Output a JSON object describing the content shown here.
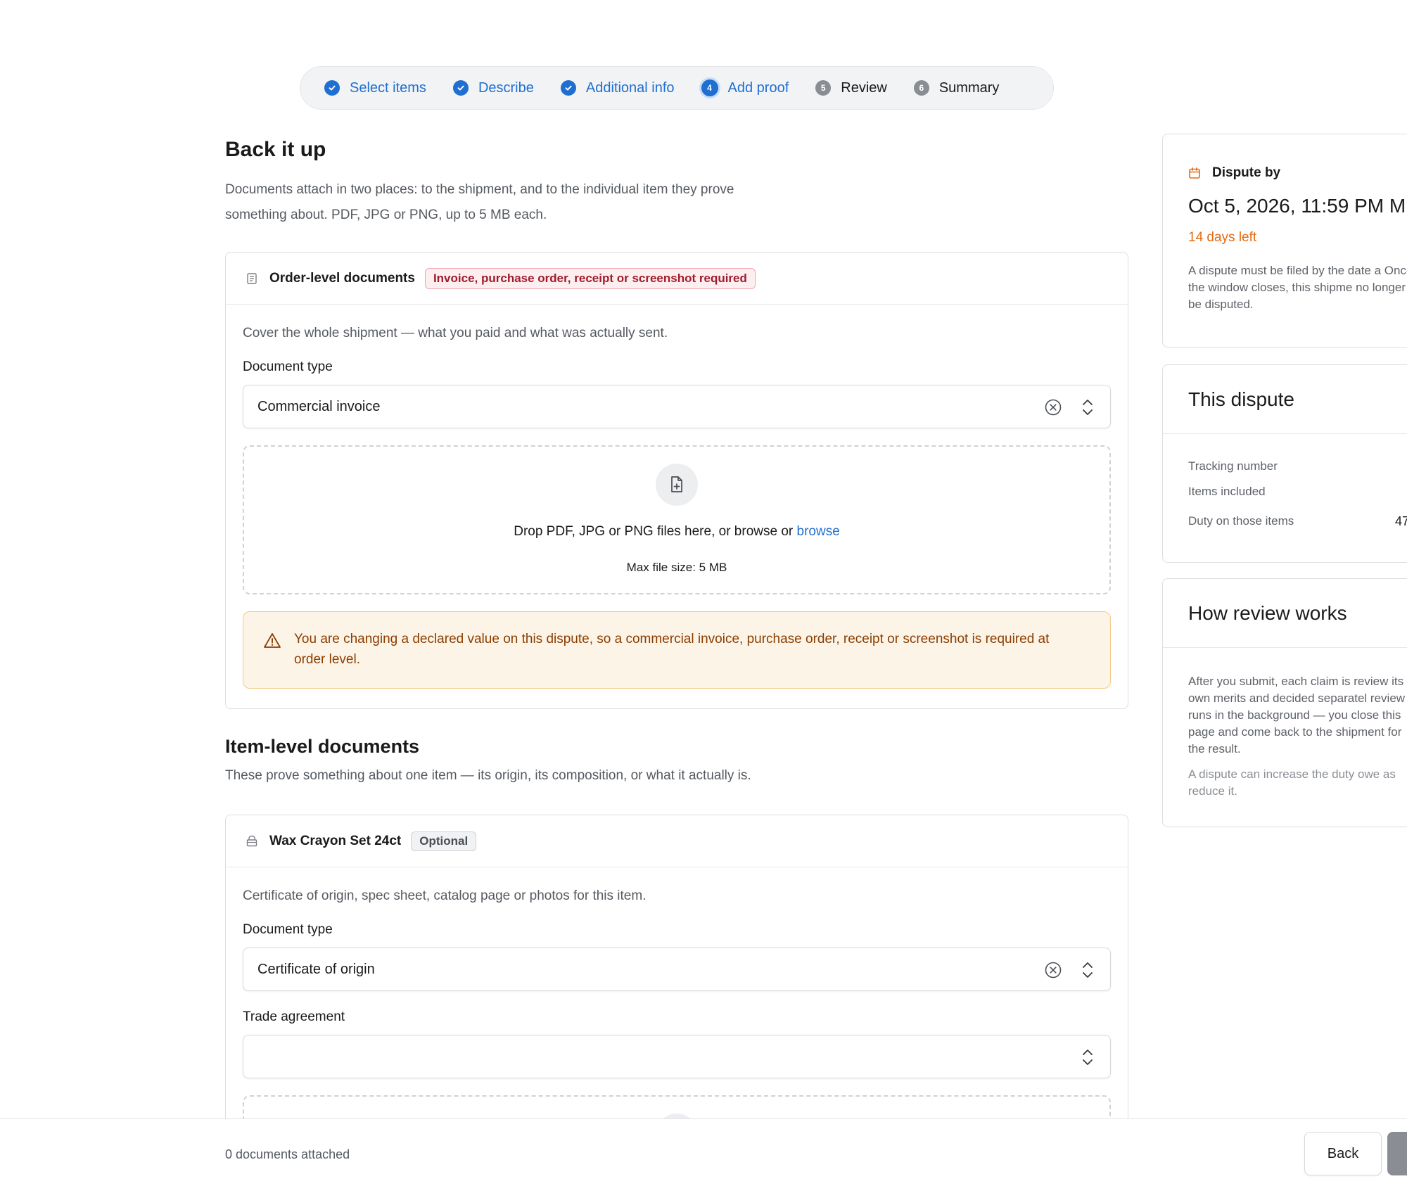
{
  "stepper": {
    "steps": [
      {
        "label": "Select items",
        "status": "done"
      },
      {
        "label": "Describe",
        "status": "done"
      },
      {
        "label": "Additional info",
        "status": "done"
      },
      {
        "label": "Add proof",
        "status": "current",
        "number": "4"
      },
      {
        "label": "Review",
        "status": "todo",
        "number": "5"
      },
      {
        "label": "Summary",
        "status": "todo",
        "number": "6"
      }
    ]
  },
  "page": {
    "title": "Back it up",
    "intro": "Documents attach in two places: to the shipment, and to the individual item they prove something about. PDF, JPG or PNG, up to 5 MB each."
  },
  "order_docs": {
    "title": "Order-level documents",
    "badge": "Invoice, purchase order, receipt or screenshot required",
    "description": "Cover the whole shipment — what you paid and what was actually sent.",
    "doc_type_label": "Document type",
    "doc_type_value": "Commercial invoice",
    "drop_text": "Drop PDF, JPG or PNG files here, or browse or",
    "drop_link": "browse",
    "max_size": "Max file size: 5 MB",
    "warning": "You are changing a declared value on this dispute, so a commercial invoice, purchase order, receipt or screenshot is required at order level."
  },
  "item_section": {
    "title": "Item-level documents",
    "subtitle": "These prove something about one item — its origin, its composition, or what it actually is."
  },
  "item_docs": {
    "title": "Wax Crayon Set 24ct",
    "badge": "Optional",
    "description": "Certificate of origin, spec sheet, catalog page or photos for this item.",
    "doc_type_label": "Document type",
    "doc_type_value": "Certificate of origin",
    "trade_label": "Trade agreement",
    "trade_value": ""
  },
  "dispute_by": {
    "label": "Dispute by",
    "date": "Oct 5, 2026, 11:59 PM M",
    "days_left": "14 days left",
    "note": "A dispute must be filed by the date a Once the window closes, this shipme no longer be disputed."
  },
  "this_dispute": {
    "title": "This dispute",
    "rows": [
      {
        "label": "Tracking number",
        "value": ""
      },
      {
        "label": "Items included",
        "value": ""
      },
      {
        "label": "Duty on those items",
        "value": "47"
      }
    ]
  },
  "how_review": {
    "title": "How review works",
    "para1": "After you submit, each claim is review its own merits and decided separatel review runs in the background — you close this page and come back to the shipment for the result.",
    "para2": "A dispute can increase the duty owe as reduce it."
  },
  "footer": {
    "count": "0 documents attached",
    "back_label": "Back"
  },
  "colors": {
    "accent": "#1f6fd1",
    "warning_text": "#8a3d00",
    "deadline": "#e36a12",
    "error_badge": "#a01c2c"
  }
}
